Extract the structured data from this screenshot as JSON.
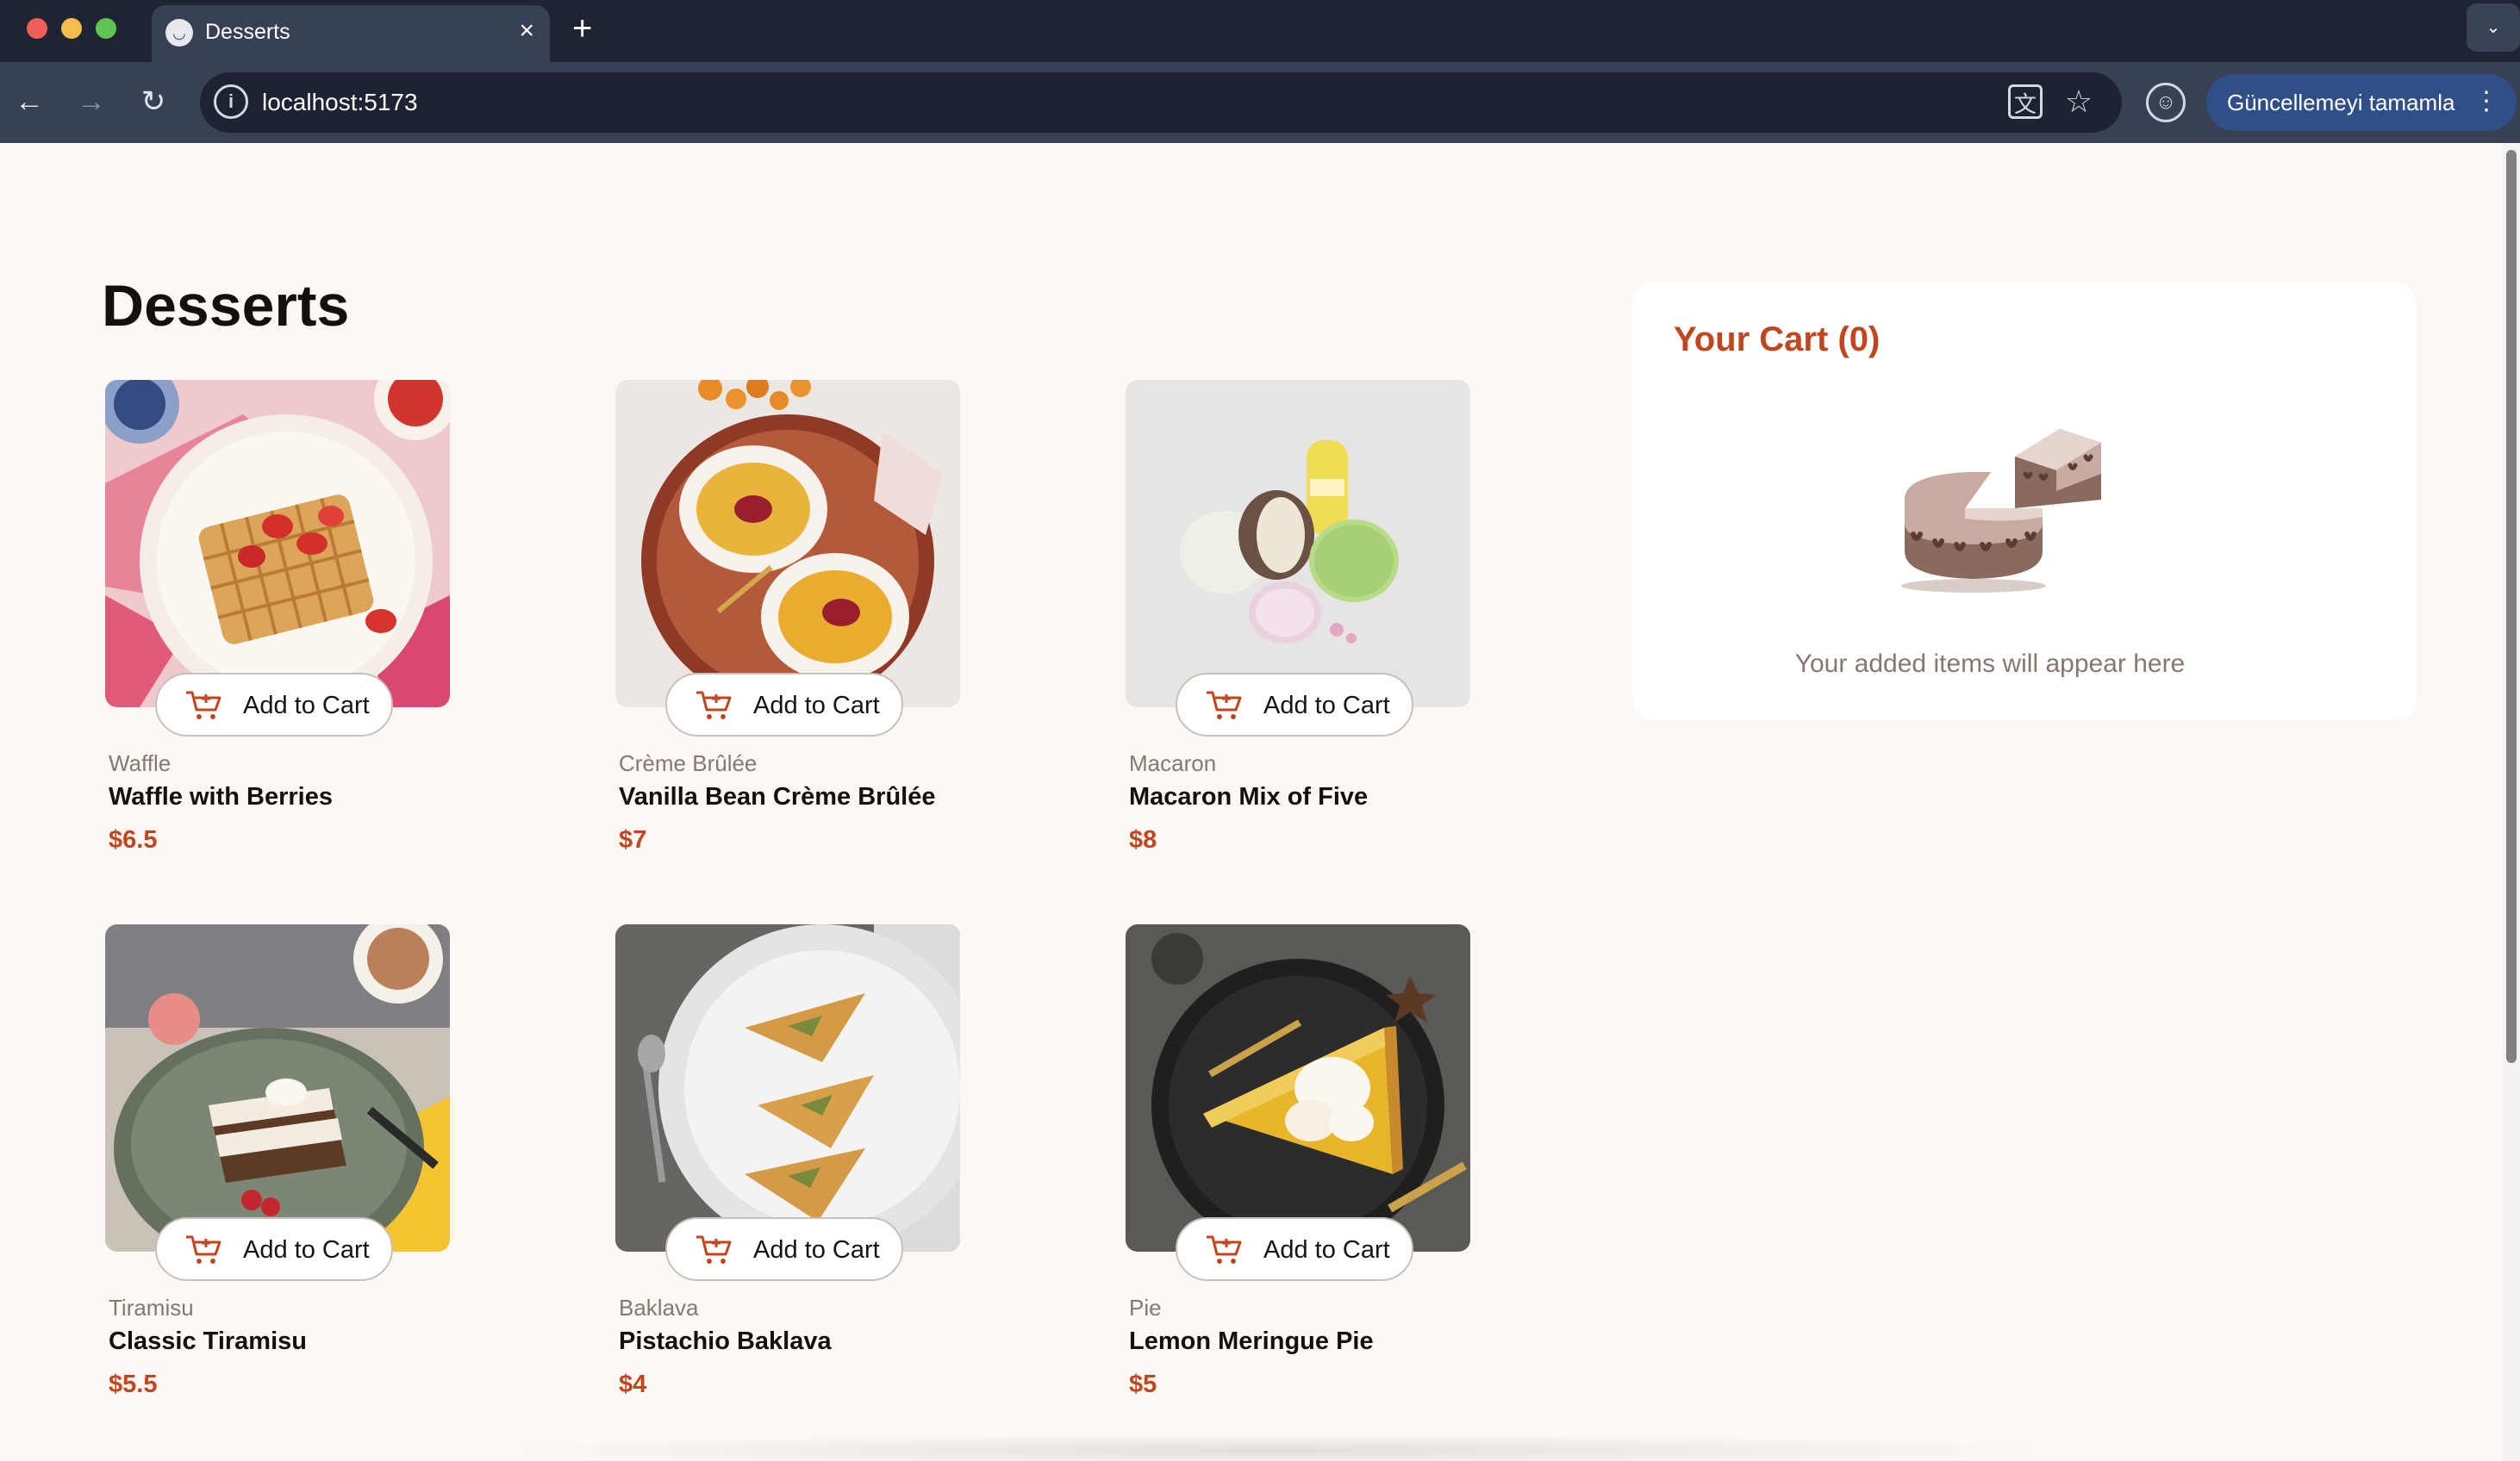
{
  "browser": {
    "tab_title": "Desserts",
    "tab_close_icon": "×",
    "new_tab_icon": "+",
    "tab_menu_icon": "⌄",
    "url": "localhost:5173",
    "update_label": "Güncellemeyi tamamla",
    "update_menu_icon": "⋮"
  },
  "page": {
    "title": "Desserts",
    "add_to_cart_label": "Add to Cart"
  },
  "products": [
    {
      "category": "Waffle",
      "name": "Waffle with Berries",
      "price": "$6.5",
      "image_icon": "waffle-image"
    },
    {
      "category": "Crème Brûlée",
      "name": "Vanilla Bean Crème Brûlée",
      "price": "$7",
      "image_icon": "creme-brulee-image"
    },
    {
      "category": "Macaron",
      "name": "Macaron Mix of Five",
      "price": "$8",
      "image_icon": "macaron-image"
    },
    {
      "category": "Tiramisu",
      "name": "Classic Tiramisu",
      "price": "$5.5",
      "image_icon": "tiramisu-image"
    },
    {
      "category": "Baklava",
      "name": "Pistachio Baklava",
      "price": "$4",
      "image_icon": "baklava-image"
    },
    {
      "category": "Pie",
      "name": "Lemon Meringue Pie",
      "price": "$5",
      "image_icon": "pie-image"
    }
  ],
  "cart": {
    "title": "Your Cart (0)",
    "empty_message": "Your added items will appear here",
    "illustration_icon": "empty-cake-illustration"
  },
  "colors": {
    "accent": "#c2451e",
    "page_background": "#fcf8f6",
    "muted_text": "#86786f"
  }
}
